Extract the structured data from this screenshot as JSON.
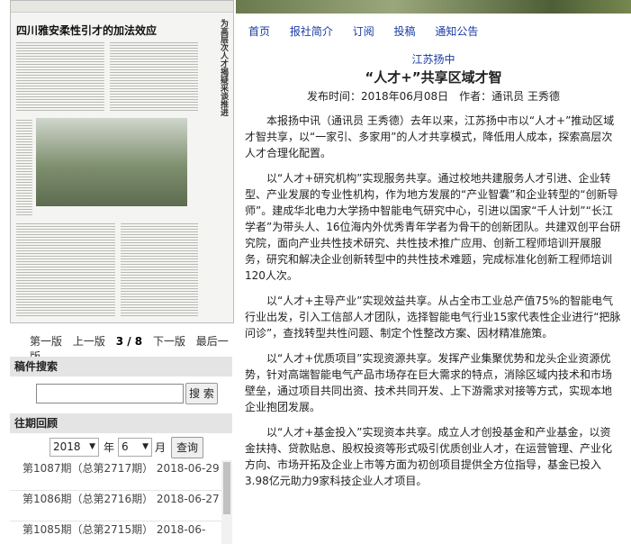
{
  "paper": {
    "headline": "四川雅安柔性引才的加法效应",
    "side_text": "为高层次人才揭疑采谈推进"
  },
  "pager": {
    "first": "第一版",
    "prev": "上一版",
    "current": "3 / 8",
    "next": "下一版",
    "last": "最后一版"
  },
  "search": {
    "title": "稿件搜索",
    "button": "搜 索"
  },
  "archive": {
    "title": "往期回顾",
    "year": "2018",
    "year_unit": "年",
    "month": "6",
    "month_unit": "月",
    "button": "查询",
    "issues": [
      "第1087期（总第2717期） 2018-06-29",
      "第1086期（总第2716期） 2018-06-27",
      "第1085期（总第2715期） 2018-06-"
    ]
  },
  "nav": [
    "首页",
    "报社简介",
    "订阅",
    "投稿",
    "通知公告"
  ],
  "article": {
    "section": "江苏扬中",
    "title": "“人才+”共享区域才智",
    "meta": "发布时间：2018年06月08日　作者：通讯员 王秀德",
    "paragraphs": [
      "本报扬中讯（通讯员 王秀德）去年以来，江苏扬中市以“人才+”推动区域才智共享，以“一家引、多家用”的人才共享模式，降低用人成本，探索高层次人才合理化配置。",
      "以“人才+研究机构”实现服务共享。通过校地共建服务人才引进、企业转型、产业发展的专业性机构，作为地方发展的“产业智囊”和企业转型的“创新导师”。建成华北电力大学扬中智能电气研究中心，引进以国家“千人计划”“长江学者”为带头人、16位海内外优秀青年学者为骨干的创新团队。共建双创平台研究院，面向产业共性技术研究、共性技术推广应用、创新工程师培训开展服务，研究和解决企业创新转型中的共性技术难题，完成标准化创新工程师培训120人次。",
      "以“人才+主导产业”实现效益共享。从占全市工业总产值75%的智能电气行业出发，引入工信部人才团队，选择智能电气行业15家代表性企业进行“把脉问诊”，查找转型共性问题、制定个性整改方案、因材精准施策。",
      "以“人才+优质项目”实现资源共享。发挥产业集聚优势和龙头企业资源优势，针对高端智能电气产品市场存在巨大需求的特点，消除区域内技术和市场壁垒，通过项目共同出资、技术共同开发、上下游需求对接等方式，实现本地企业抱团发展。",
      "以“人才+基金投入”实现资本共享。成立人才创投基金和产业基金，以资金扶持、贷款贴息、股权投资等形式吸引优质创业人才，在运营管理、产业化方向、市场开拓及企业上市等方面为初创项目提供全方位指导，基金已投入3.98亿元助力9家科技企业人才项目。"
    ]
  }
}
